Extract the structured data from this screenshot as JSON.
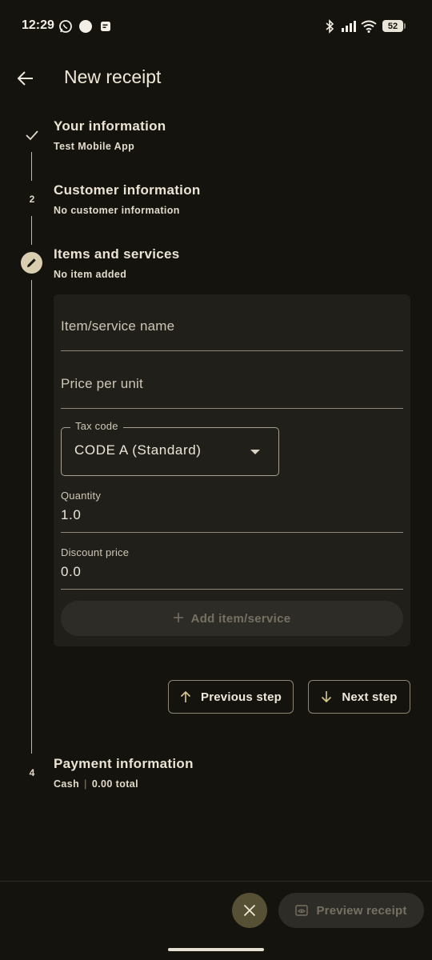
{
  "status_bar": {
    "time": "12:29",
    "battery": "52",
    "left_icons": [
      "whatsapp-icon",
      "circle-notification-icon",
      "note-icon"
    ],
    "right_icons": [
      "bluetooth-icon",
      "signal-icon",
      "wifi-icon",
      "battery-icon"
    ]
  },
  "header": {
    "title": "New receipt",
    "back_icon": "arrow-left-icon"
  },
  "steps": [
    {
      "indicator": "check-icon",
      "title": "Your information",
      "subtitle": "Test Mobile App",
      "state": "completed"
    },
    {
      "indicator": "2",
      "title": "Customer information",
      "subtitle": "No customer information",
      "state": "pending"
    },
    {
      "indicator": "pencil-icon",
      "title": "Items and services",
      "subtitle": "No item added",
      "state": "active"
    },
    {
      "indicator": "4",
      "title": "Payment information",
      "subtitle_method": "Cash",
      "subtitle_separator": "|",
      "subtitle_total": "0.00 total",
      "state": "pending"
    }
  ],
  "item_form": {
    "name_placeholder": "Item/service name",
    "price_placeholder": "Price per unit",
    "tax_code_label": "Tax code",
    "tax_code_value": "CODE A (Standard)",
    "quantity_label": "Quantity",
    "quantity_value": "1.0",
    "discount_label": "Discount price",
    "discount_value": "0.0",
    "add_button": "Add item/service"
  },
  "navigation": {
    "previous_step": "Previous step",
    "next_step": "Next step"
  },
  "bottom_bar": {
    "preview_button": "Preview receipt"
  },
  "colors": {
    "background": "#15130e",
    "card": "#211f1a",
    "accent": "#d9cfb0",
    "active_line": "#c8b98a",
    "disabled_text": "#767063"
  }
}
